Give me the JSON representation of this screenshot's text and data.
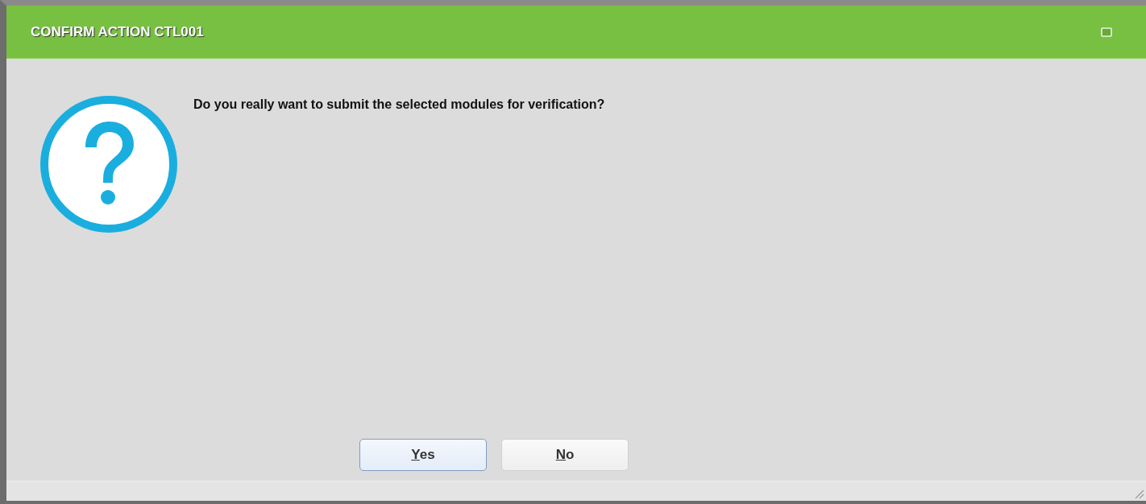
{
  "window": {
    "title": "CONFIRM ACTION CTL001"
  },
  "message": "Do you really want to submit the selected modules for verification?",
  "buttons": [
    {
      "label": "Yes",
      "selected": true
    },
    {
      "label": "No",
      "selected": false
    }
  ]
}
